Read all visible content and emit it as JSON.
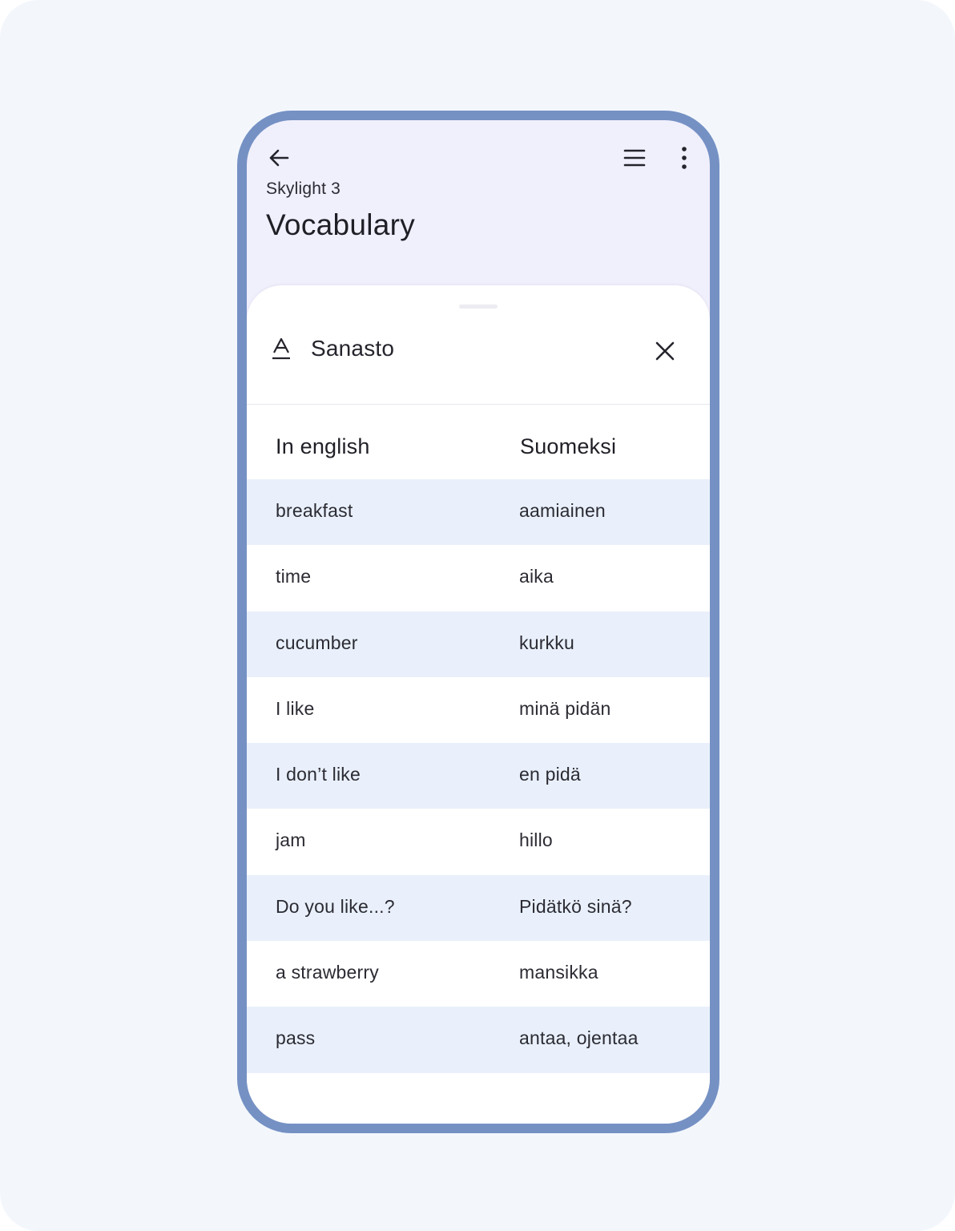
{
  "header": {
    "course": "Skylight 3",
    "title": "Vocabulary",
    "icons": {
      "back": "arrow-left-icon",
      "menu": "hamburger-menu-icon",
      "more": "more-vertical-icon"
    }
  },
  "sheet": {
    "icon": "text-format-icon",
    "title": "Sanasto",
    "close_icon": "close-icon"
  },
  "table": {
    "columns": {
      "en": "In english",
      "fi": "Suomeksi"
    },
    "rows": [
      {
        "en": "breakfast",
        "fi": "aamiainen"
      },
      {
        "en": "time",
        "fi": "aika"
      },
      {
        "en": "cucumber",
        "fi": "kurkku"
      },
      {
        "en": "I like",
        "fi": "minä pidän"
      },
      {
        "en": "I don’t like",
        "fi": "en pidä"
      },
      {
        "en": "jam",
        "fi": "hillo"
      },
      {
        "en": "Do you like...?",
        "fi": "Pidätkö sinä?"
      },
      {
        "en": "a strawberry",
        "fi": "mansikka"
      },
      {
        "en": "pass",
        "fi": "antaa, ojentaa"
      }
    ]
  },
  "colors": {
    "page_background": "#f3f7fc",
    "phone_frame": "#7591c4",
    "header_background": "#f0effc",
    "row_alt": "#e9f0fb"
  }
}
